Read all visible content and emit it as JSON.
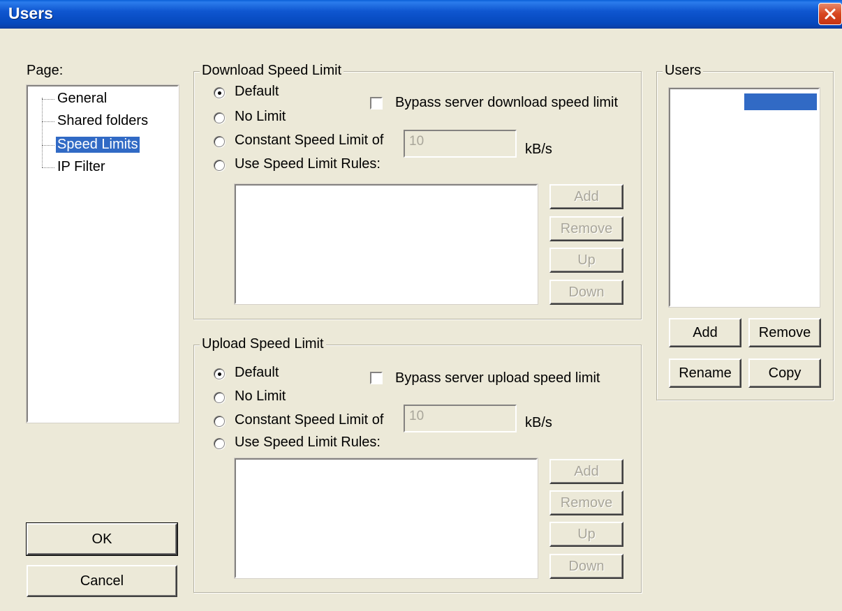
{
  "window": {
    "title": "Users",
    "close_icon": "close-icon"
  },
  "page_panel": {
    "label": "Page:",
    "items": [
      {
        "label": "General",
        "selected": false
      },
      {
        "label": "Shared folders",
        "selected": false
      },
      {
        "label": "Speed Limits",
        "selected": true
      },
      {
        "label": "IP Filter",
        "selected": false
      }
    ]
  },
  "download": {
    "group_title": "Download Speed Limit",
    "options": [
      "Default",
      "No Limit",
      "Constant Speed Limit of",
      "Use Speed Limit Rules:"
    ],
    "selected": "Default",
    "bypass_label": "Bypass server download speed limit",
    "bypass_checked": false,
    "limit_value": "10",
    "unit": "kB/s",
    "rule_buttons": [
      "Add",
      "Remove",
      "Up",
      "Down"
    ]
  },
  "upload": {
    "group_title": "Upload Speed Limit",
    "options": [
      "Default",
      "No Limit",
      "Constant Speed Limit of",
      "Use Speed Limit Rules:"
    ],
    "selected": "Default",
    "bypass_label": "Bypass server upload speed limit",
    "bypass_checked": false,
    "limit_value": "10",
    "unit": "kB/s",
    "rule_buttons": [
      "Add",
      "Remove",
      "Up",
      "Down"
    ]
  },
  "users_panel": {
    "group_title": "Users",
    "buttons": {
      "add": "Add",
      "remove": "Remove",
      "rename": "Rename",
      "copy": "Copy"
    }
  },
  "footer": {
    "ok": "OK",
    "cancel": "Cancel"
  },
  "colors": {
    "titlebar": "#0548bc",
    "selection": "#316ac5",
    "face": "#ece9d8"
  }
}
